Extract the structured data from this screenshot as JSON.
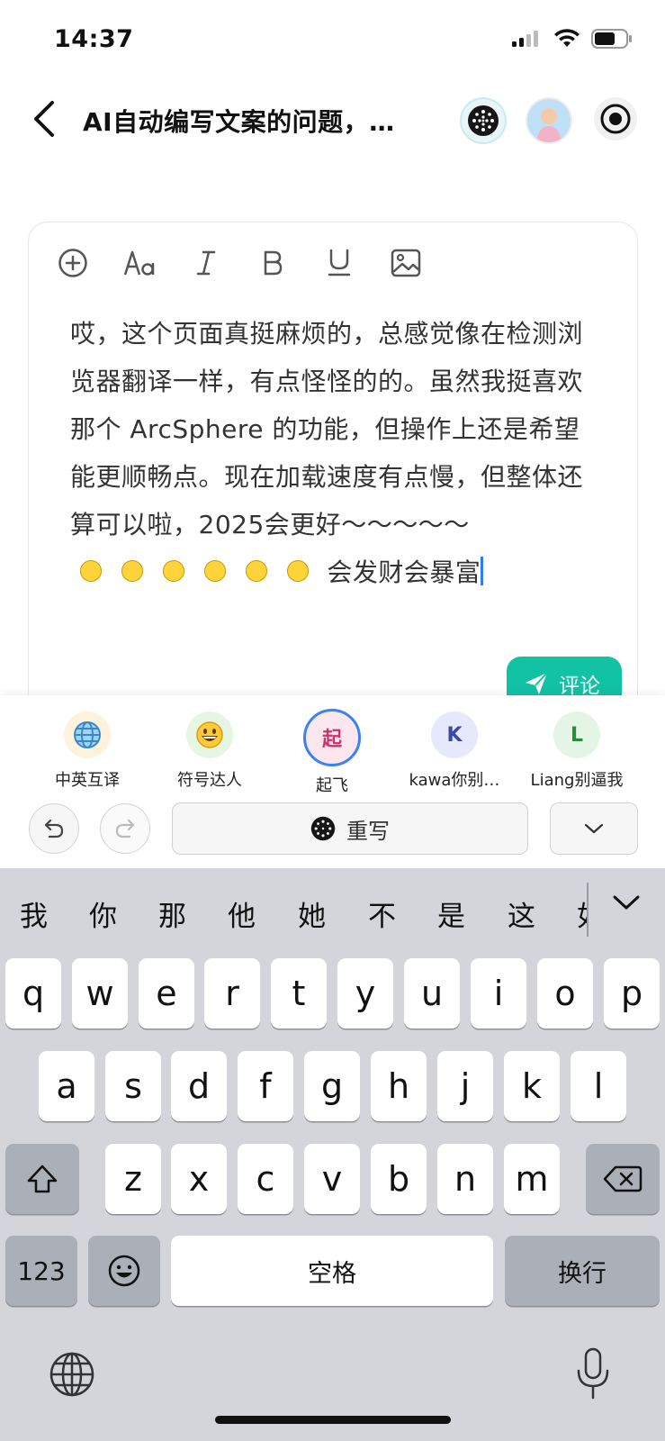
{
  "status_bar": {
    "time": "14:37"
  },
  "header": {
    "title": "AI自动编写文案的问题，…"
  },
  "editor": {
    "text": "哎，这个页面真挺麻烦的，总感觉像在检测浏览器翻译一样，有点怪怪的的。虽然我挺喜欢那个 ArcSphere 的功能，但操作上还是希望能更顺畅点。现在加载速度有点慢，但整体还算可以啦，2025会更好～～～～～",
    "emoji_count": 6,
    "tail_text": "会发财会暴富",
    "comment_label": "评论"
  },
  "personas": [
    {
      "label": "中英互译",
      "avatar": "🌐",
      "avatar_icon": "globe-icon"
    },
    {
      "label": "符号达人",
      "avatar": "😄",
      "avatar_icon": "grin-emoji-icon"
    },
    {
      "label": "起飞",
      "avatar": "起",
      "selected": true
    },
    {
      "label": "kawa你别…",
      "avatar": "K"
    },
    {
      "label": "Liang别逼我",
      "avatar": "L"
    }
  ],
  "rewrite_label": "重写",
  "keyboard": {
    "candidates": [
      "我",
      "你",
      "那",
      "他",
      "她",
      "不",
      "是",
      "这",
      "如"
    ],
    "row1": [
      "q",
      "w",
      "e",
      "r",
      "t",
      "y",
      "u",
      "i",
      "o",
      "p"
    ],
    "row2": [
      "a",
      "s",
      "d",
      "f",
      "g",
      "h",
      "j",
      "k",
      "l"
    ],
    "row3": [
      "z",
      "x",
      "c",
      "v",
      "b",
      "n",
      "m"
    ],
    "numbers_label": "123",
    "space_label": "空格",
    "return_label": "换行"
  },
  "colors": {
    "accent": "#12c2a5",
    "caret": "#2f7cf6",
    "selected_ring": "#3b82f6"
  }
}
